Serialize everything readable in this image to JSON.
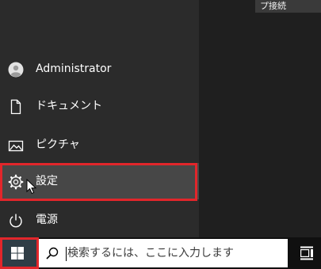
{
  "desktop": {
    "connection_label": "プ接続"
  },
  "start_menu": {
    "items": [
      {
        "label": "Administrator",
        "icon": "user-avatar-icon"
      },
      {
        "label": "ドキュメント",
        "icon": "document-icon"
      },
      {
        "label": "ピクチャ",
        "icon": "pictures-icon"
      },
      {
        "label": "設定",
        "icon": "gear-icon"
      },
      {
        "label": "電源",
        "icon": "power-icon"
      }
    ]
  },
  "taskbar": {
    "start_icon": "windows-logo-icon",
    "search_placeholder": "検索するには、ここに入力します",
    "search_icon": "search-icon",
    "task_view_icon": "task-view-icon"
  },
  "colors": {
    "highlight": "#e2262b",
    "menu_background": "#2b2b2b",
    "selected_item": "#474747",
    "taskbar": "#101010",
    "start_button": "#2f3d46"
  }
}
